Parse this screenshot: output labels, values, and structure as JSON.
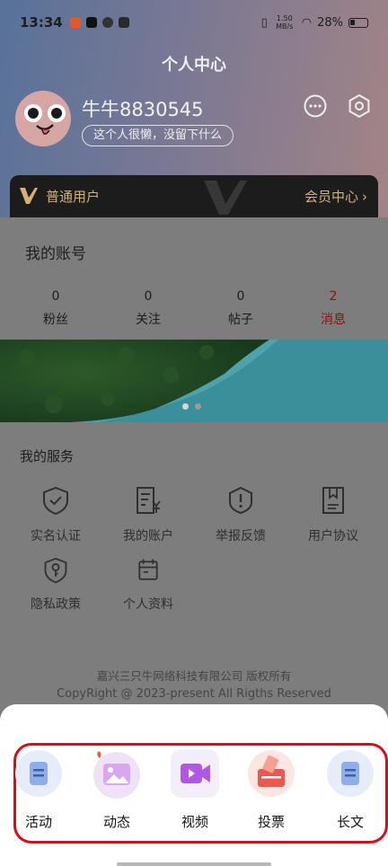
{
  "status_bar": {
    "time": "13:34",
    "speed": "1.50 MB/s",
    "battery": "28%"
  },
  "header": {
    "title": "个人中心",
    "username": "牛牛8830545",
    "bio": "这个人很懒，没留下什么",
    "membership": {
      "level": "普通用户",
      "center": "会员中心"
    }
  },
  "account": {
    "title": "我的账号",
    "stats": [
      {
        "value": "0",
        "label": "粉丝"
      },
      {
        "value": "0",
        "label": "关注"
      },
      {
        "value": "0",
        "label": "帖子"
      },
      {
        "value": "2",
        "label": "消息"
      }
    ]
  },
  "banner": {
    "slides": 2,
    "current": 1
  },
  "services": {
    "title": "我的服务",
    "items": [
      {
        "label": "实名认证",
        "icon": "shield-check-icon"
      },
      {
        "label": "我的账户",
        "icon": "account-bill-icon"
      },
      {
        "label": "举报反馈",
        "icon": "report-alert-icon"
      },
      {
        "label": "用户协议",
        "icon": "agreement-doc-icon"
      },
      {
        "label": "隐私政策",
        "icon": "privacy-key-icon"
      },
      {
        "label": "个人资料",
        "icon": "calendar-profile-icon"
      }
    ]
  },
  "footer": {
    "company": "嘉兴三只牛网络科技有限公司 版权所有",
    "copyright": "CopyRight @ 2023-present All Rigths Reserved"
  },
  "post_menu": {
    "items": [
      {
        "label": "活动",
        "icon": "activity-doc-icon"
      },
      {
        "label": "动态",
        "icon": "image-post-icon"
      },
      {
        "label": "视频",
        "icon": "video-camera-icon"
      },
      {
        "label": "投票",
        "icon": "vote-box-icon"
      },
      {
        "label": "长文",
        "icon": "article-doc-icon"
      }
    ]
  },
  "colors": {
    "accent_red": "#d40f19",
    "gold": "#d4b079",
    "message_red": "#8c1010"
  }
}
